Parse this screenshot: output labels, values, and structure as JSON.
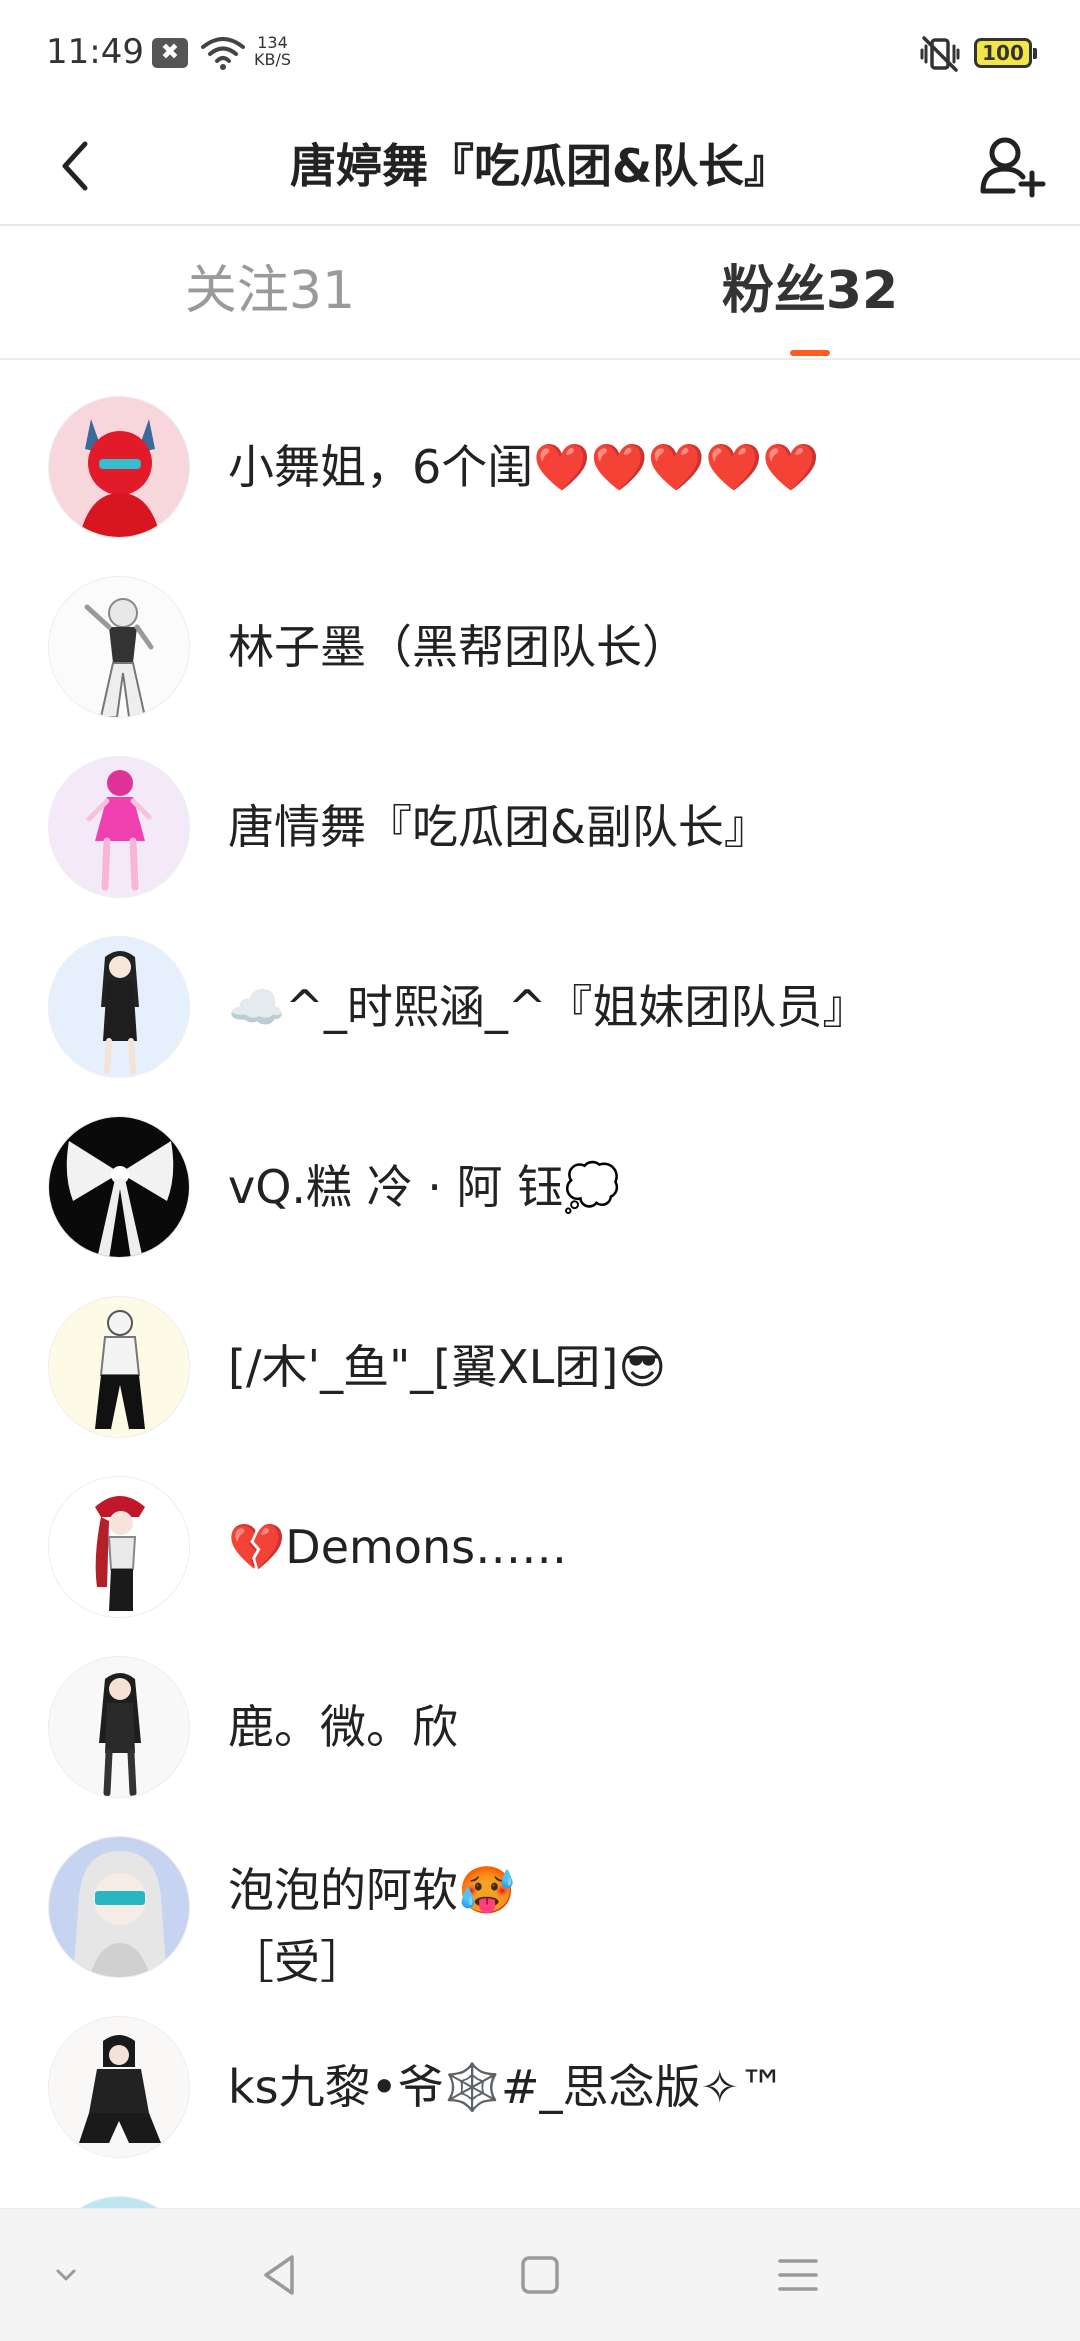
{
  "status_bar": {
    "time": "11:49",
    "notification_glyph": "✖",
    "net_speed_value": "134",
    "net_speed_unit": "KB/S",
    "battery": "100",
    "battery_color": "#f2e54a",
    "icons": [
      "wifi-icon",
      "vibrate-icon",
      "battery-icon"
    ]
  },
  "header": {
    "title": "唐婷舞『吃瓜团&队长』",
    "back_icon": "back-chevron-icon",
    "add_icon": "add-user-icon"
  },
  "tabs": [
    {
      "label": "关注31",
      "active": false
    },
    {
      "label": "粉丝32",
      "active": true
    }
  ],
  "accent_color": "#ff5a1f",
  "fans": [
    {
      "name": "小舞姐，6个闺❤️❤️❤️❤️❤️",
      "avatar": "red-character-avatar"
    },
    {
      "name": "林子墨（黑帮团队长）",
      "avatar": "white-outfit-character-avatar"
    },
    {
      "name": "唐情舞『吃瓜团&副队长』",
      "avatar": "pink-character-avatar"
    },
    {
      "name": "☁️^_时熙涵_^『姐妹团队员』",
      "avatar": "black-dress-character-avatar"
    },
    {
      "name": "vQ.糕 冷 · 阿 钰💭",
      "avatar": "black-ribbon-avatar"
    },
    {
      "name": "[/木'_鱼\"_[翼XL团]😎",
      "avatar": "masked-character-avatar"
    },
    {
      "name": "💔Demons……",
      "avatar": "red-hat-character-avatar"
    },
    {
      "name": "鹿。微。欣",
      "avatar": "dark-hair-character-avatar"
    },
    {
      "name": "泡泡的阿软🥵\n［受］",
      "avatar": "silver-hair-character-avatar"
    },
    {
      "name": "ks九黎•爷🕸️#_思念版✧™",
      "avatar": "crouching-character-avatar"
    }
  ],
  "bottom_nav": [
    "collapse-icon",
    "back-triangle-icon",
    "home-square-icon",
    "menu-lines-icon"
  ]
}
